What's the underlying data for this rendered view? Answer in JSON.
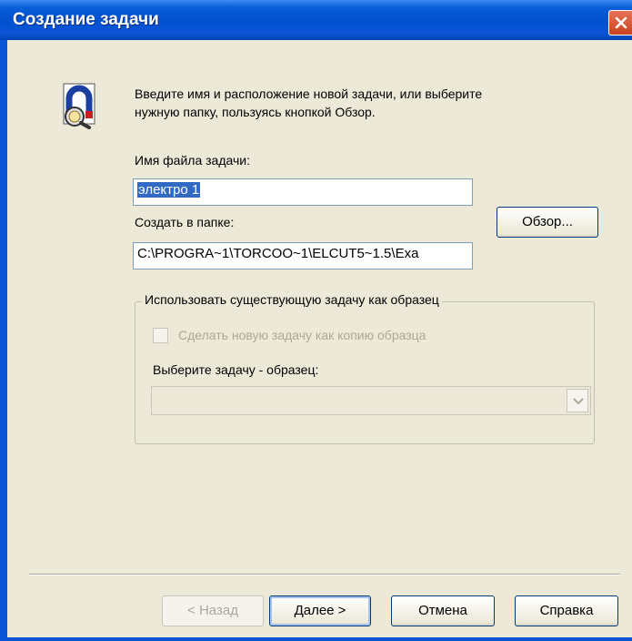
{
  "dialog": {
    "title": "Создание задачи",
    "intro_line1": "Введите имя и расположение новой задачи, или выберите",
    "intro_line2": "нужную папку, пользуясь кнопкой Обзор.",
    "filename_label": "Имя файла задачи:",
    "filename_value": "электро 1",
    "folder_label": "Создать в папке:",
    "folder_value": "C:\\PROGRA~1\\TORCOO~1\\ELCUT5~1.5\\Exa",
    "browse_label": "Обзор...",
    "group_label": "Использовать существующую задачу как образец",
    "copy_checkbox_label": "Сделать новую задачу как копию образца",
    "copy_checked": false,
    "template_label": "Выберите задачу - образец:",
    "template_value": ""
  },
  "buttons": {
    "back": "< Назад",
    "next": "Далее >",
    "cancel": "Отмена",
    "help": "Справка"
  },
  "icons": {
    "close": "close-icon",
    "app": "magnet-icon",
    "dropdown": "chevron-down-icon"
  },
  "colors": {
    "titlebar": "#0a55d6",
    "dialog_bg": "#ece9d8",
    "selection": "#316ac5",
    "close": "#d9532b"
  }
}
